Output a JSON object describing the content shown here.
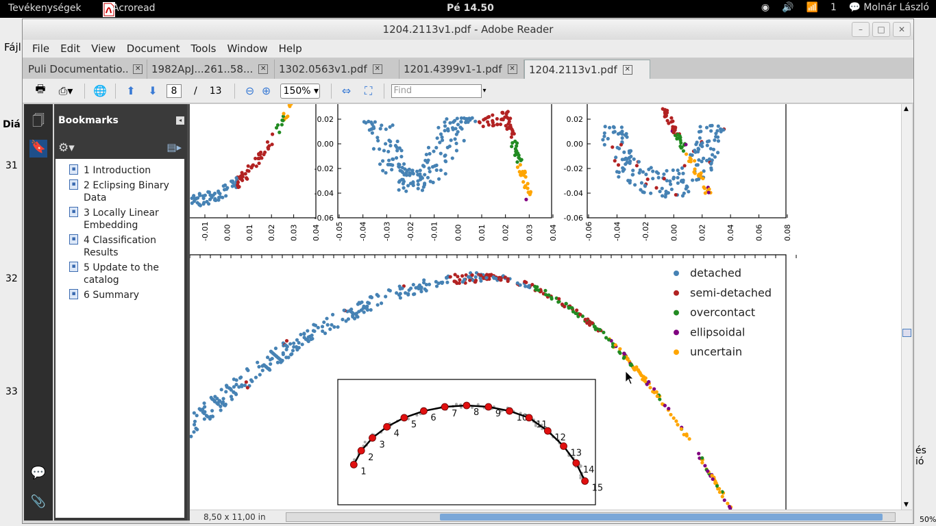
{
  "topbar": {
    "activities": "Tevékenységek",
    "app": "Acroread",
    "clock": "Pé 14.50",
    "workspace": "1",
    "user": "Molnár László"
  },
  "background_window": {
    "menu": "Fájl",
    "label": "Diá",
    "rows": [
      "31",
      "32",
      "33"
    ],
    "right_text": [
      "és",
      "ió"
    ],
    "zoom_fragment": "50%"
  },
  "window": {
    "title": "1204.2113v1.pdf -  Adobe Reader",
    "menu": [
      "File",
      "Edit",
      "View",
      "Document",
      "Tools",
      "Window",
      "Help"
    ],
    "tabs": [
      {
        "label": "Puli Documentatio...",
        "active": false
      },
      {
        "label": "1982ApJ...261..58...",
        "active": false
      },
      {
        "label": "1302.0563v1.pdf",
        "active": false
      },
      {
        "label": "1201.4399v1-1.pdf",
        "active": false
      },
      {
        "label": "1204.2113v1.pdf",
        "active": true
      }
    ]
  },
  "toolbar": {
    "page_current": "8",
    "page_sep": "/",
    "page_total": "13",
    "zoom": "150%",
    "find_placeholder": "Find"
  },
  "bookmarks": {
    "title": "Bookmarks",
    "items": [
      "1 Introduction",
      "2 Eclipsing Binary Data",
      "3 Locally Linear Embedding",
      "4 Classification Results",
      "5 Update to the catalog",
      "6 Summary"
    ]
  },
  "status": {
    "page_size": "8,50 x 11,00 in"
  },
  "chart_data": [
    {
      "type": "scatter",
      "xticks": [
        "-0.01",
        "0.00",
        "0.01",
        "0.02",
        "0.03",
        "0.04"
      ],
      "yticks": []
    },
    {
      "type": "scatter",
      "xticks": [
        "-0.05",
        "-0.04",
        "-0.03",
        "-0.02",
        "-0.01",
        "0.00",
        "0.01",
        "0.02",
        "0.03",
        "0.04"
      ],
      "yticks": [
        "0.02",
        "0.00",
        "-0.02",
        "-0.04",
        "-0.06"
      ]
    },
    {
      "type": "scatter",
      "xticks": [
        "-0.06",
        "-0.04",
        "-0.02",
        "0.00",
        "0.02",
        "0.04",
        "0.06",
        "0.08"
      ],
      "yticks": [
        "0.02",
        "0.00",
        "-0.02",
        "-0.04",
        "-0.06"
      ]
    },
    {
      "type": "scatter",
      "legend": [
        "detached",
        "semi-detached",
        "overcontact",
        "ellipsoidal",
        "uncertain"
      ],
      "legend_colors": [
        "#4682b4",
        "#b22222",
        "#228b22",
        "#800080",
        "#ffa500"
      ],
      "legend_position": "top-right",
      "inset_labels": [
        "1",
        "2",
        "3",
        "4",
        "5",
        "6",
        "7",
        "8",
        "9",
        "10",
        "11",
        "12",
        "13",
        "14",
        "15"
      ]
    }
  ]
}
